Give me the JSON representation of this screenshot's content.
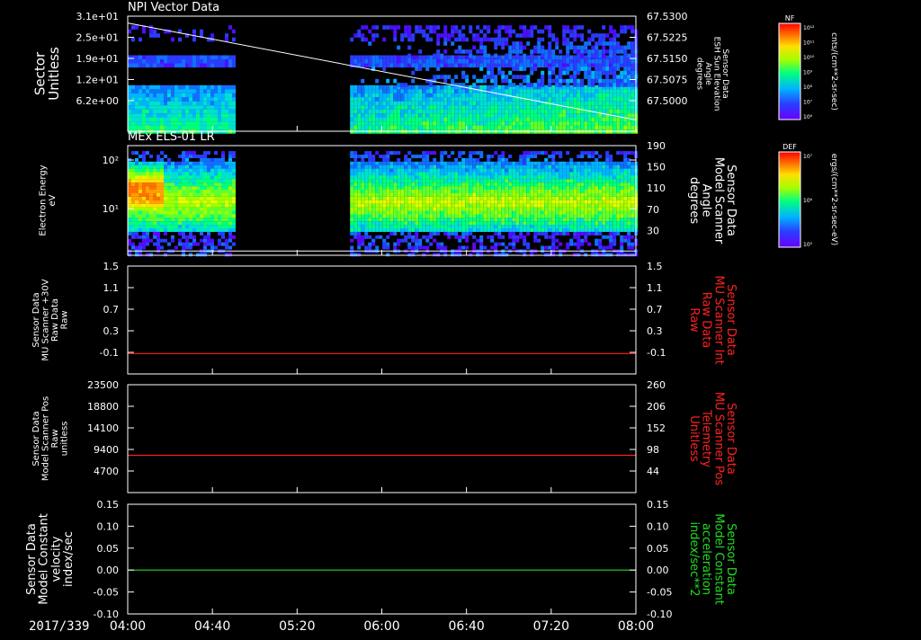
{
  "date_label": "2017/339",
  "time_ticks": [
    "04:00",
    "04:40",
    "05:20",
    "06:00",
    "06:40",
    "07:20",
    "08:00"
  ],
  "colors": {
    "white": "#ffffff",
    "red": "#ff2020",
    "green": "#22dd22",
    "background": "#000000"
  },
  "chart_data": [
    {
      "type": "heatmap",
      "title": "NPI Vector Data",
      "ylabel_lines": [
        "Sector",
        "Unitless"
      ],
      "yticks": [
        "3.1e+01",
        "2.5e+01",
        "1.9e+01",
        "1.2e+01",
        "6.2e+00"
      ],
      "right_ylabel_lines": [
        "Sensor Data",
        "ESH Sun Elevation",
        "Angle",
        "degrees"
      ],
      "right_yticks": [
        "67.5300",
        "67.5225",
        "67.5150",
        "67.5075",
        "67.5000"
      ],
      "right_ylim": [
        67.4965,
        67.53
      ],
      "data_gap": [
        "04:50",
        "05:45"
      ],
      "line_series": {
        "x": [
          "04:00",
          "08:00"
        ],
        "y": [
          67.528,
          67.4998
        ]
      },
      "colorbar": {
        "label": "NF",
        "ticks": [
          "10¹²",
          "10¹¹",
          "10¹⁰",
          "10⁹",
          "10⁸",
          "10⁷",
          "10⁶"
        ],
        "units": "cnts/(cm**2-sr-sec)"
      }
    },
    {
      "type": "heatmap",
      "title": "MEx ELS-01 LR",
      "ylabel_lines": [
        "Electron Energy",
        "eV"
      ],
      "yticks": [
        "10²",
        "10¹"
      ],
      "yscale": "log",
      "right_ylabel_lines": [
        "Sensor Data",
        "Model Scanner",
        "Angle",
        "degrees"
      ],
      "right_yticks": [
        "190",
        "150",
        "110",
        "70",
        "30"
      ],
      "right_ylim": [
        10,
        190
      ],
      "data_gap": [
        "04:50",
        "05:45"
      ],
      "line_series": {
        "x": [
          "04:00",
          "08:00"
        ],
        "y": [
          17,
          17
        ]
      },
      "colorbar": {
        "label": "DEF",
        "ticks": [
          "10⁷",
          "10⁶",
          "10⁵"
        ],
        "units": "ergs/(cm**2-sr-sec-eV)"
      }
    },
    {
      "type": "line",
      "ylabel_lines": [
        "Sensor Data",
        "MU Scanner +30V",
        "Raw Data",
        "Raw"
      ],
      "yticks": [
        "1.5",
        "1.1",
        "0.7",
        "0.3",
        "-0.1"
      ],
      "ylim": [
        -0.35,
        1.5
      ],
      "right_ylabel_lines": [
        "Sensor Data",
        "MU Scanner Int",
        "Raw Data",
        "Raw"
      ],
      "right_yticks": [
        "1.5",
        "1.1",
        "0.7",
        "0.3",
        "-0.1"
      ],
      "right_ylim": [
        -0.35,
        1.5
      ],
      "series": [
        {
          "x": [
            "04:00",
            "08:00"
          ],
          "y": [
            0.0,
            0.0
          ]
        }
      ]
    },
    {
      "type": "line",
      "ylabel_lines": [
        "Sensor Data",
        "Model Scanner Pos",
        "Raw",
        "unitless"
      ],
      "yticks": [
        "23500",
        "18800",
        "14100",
        "9400",
        "4700"
      ],
      "ylim": [
        0,
        23500
      ],
      "right_ylabel_lines": [
        "Sensor Data",
        "MU Scanner Pos",
        "Telemetry",
        "Unitless"
      ],
      "right_yticks": [
        "260",
        "206",
        "152",
        "98",
        "44"
      ],
      "right_ylim": [
        0,
        260
      ],
      "series": [
        {
          "x": [
            "04:00",
            "08:00"
          ],
          "y": [
            90,
            90
          ]
        }
      ]
    },
    {
      "type": "line",
      "ylabel_lines": [
        "Sensor Data",
        "Model Constant",
        "velocity",
        "index/sec"
      ],
      "yticks": [
        "0.15",
        "0.10",
        "0.05",
        "0.00",
        "-0.05",
        "-0.10"
      ],
      "ylim": [
        -0.1,
        0.15
      ],
      "right_ylabel_lines": [
        "Sensor Data",
        "Model Constant",
        "acceleration",
        "index/sec**2"
      ],
      "right_yticks": [
        "0.15",
        "0.10",
        "0.05",
        "0.00",
        "-0.05",
        "-0.10"
      ],
      "right_ylim": [
        -0.1,
        0.15
      ],
      "series": [
        {
          "x": [
            "04:00",
            "08:00"
          ],
          "y": [
            0.0,
            0.0
          ]
        }
      ]
    }
  ]
}
